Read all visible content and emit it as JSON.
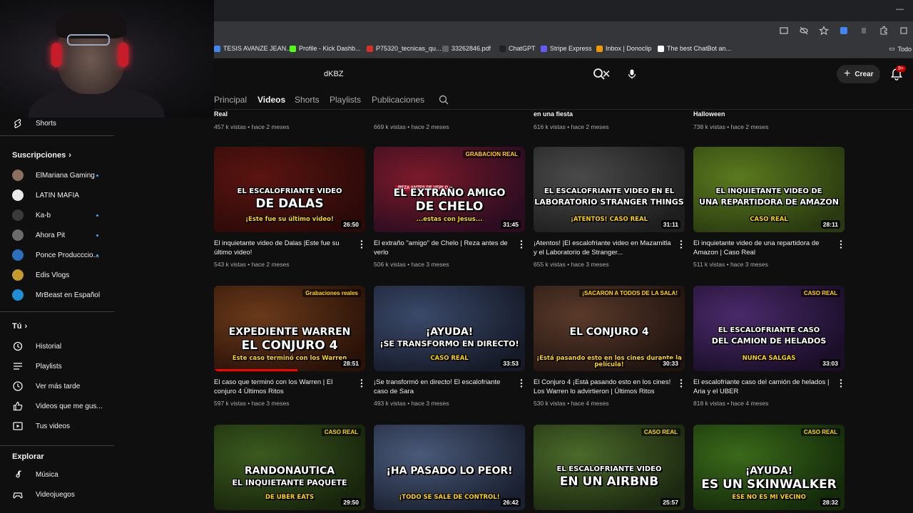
{
  "browser": {
    "bookmarks": [
      {
        "label": "TESIS AVANZE JEAN...",
        "color": "#4285f4"
      },
      {
        "label": "Profile - Kick Dashb...",
        "color": "#53fc18"
      },
      {
        "label": "P75320_tecnicas_qu...",
        "color": "#d93025"
      },
      {
        "label": "33262846.pdf",
        "color": "#5f6368"
      },
      {
        "label": "ChatGPT",
        "color": "#202124"
      },
      {
        "label": "Stripe Express",
        "color": "#635bff"
      },
      {
        "label": "Inbox | Donoclip",
        "color": "#f29900"
      },
      {
        "label": "The best ChatBot an...",
        "color": "#ffffff"
      }
    ],
    "more_bookmarks": "Todo"
  },
  "header": {
    "search_value": "dKBZ",
    "create_label": "Crear",
    "notifications": "9+"
  },
  "channel_tabs": [
    {
      "label": "Principal",
      "active": false
    },
    {
      "label": "Videos",
      "active": true
    },
    {
      "label": "Shorts",
      "active": false
    },
    {
      "label": "Playlists",
      "active": false
    },
    {
      "label": "Publicaciones",
      "active": false
    }
  ],
  "sidebar": {
    "shorts": "Shorts",
    "subscriptions_title": "Suscripciones",
    "subscriptions": [
      {
        "name": "ElMariana Gaming",
        "color": "#8a6f5c",
        "dot": true
      },
      {
        "name": "LATIN MAFIA",
        "color": "#e8e8e8",
        "dot": false
      },
      {
        "name": "Ka-b",
        "color": "#3a3a3a",
        "dot": true
      },
      {
        "name": "Ahora Pit",
        "color": "#6b6b6b",
        "dot": true
      },
      {
        "name": "Ponce Producccio...",
        "color": "#2c6fbf",
        "dot": true
      },
      {
        "name": "Edis Vlogs",
        "color": "#c49a2c",
        "dot": false
      },
      {
        "name": "MrBeast en Español",
        "color": "#1e8fd6",
        "dot": false
      }
    ],
    "you_title": "Tú",
    "you_items": [
      {
        "label": "Historial",
        "icon": "history-icon"
      },
      {
        "label": "Playlists",
        "icon": "playlists-icon"
      },
      {
        "label": "Ver más tarde",
        "icon": "watch-later-icon"
      },
      {
        "label": "Videos que me gus...",
        "icon": "like-icon"
      },
      {
        "label": "Tus videos",
        "icon": "your-videos-icon"
      }
    ],
    "explore_title": "Explorar",
    "explore_items": [
      {
        "label": "Música",
        "icon": "music-icon"
      },
      {
        "label": "Videojuegos",
        "icon": "gaming-icon"
      }
    ]
  },
  "top_row": [
    {
      "title": "Real",
      "meta": "457 k vistas • hace 2 meses"
    },
    {
      "title": "",
      "meta": "669 k vistas • hace 2 meses"
    },
    {
      "title": "en una fiesta",
      "meta": "616 k vistas • hace 2 meses"
    },
    {
      "title": "Halloween",
      "meta": "738 k vistas • hace 2 meses"
    }
  ],
  "videos": [
    {
      "title": "El inquietante video de Dalas |Este fue su último video!",
      "meta": "543 k vistas • hace 2 meses",
      "duration": "26:50",
      "thumb_text": "EL ESCALOFRIANTE VIDEO",
      "thumb_big": "DE DALAS",
      "thumb_sub": "¡Este fue su último video!",
      "bg": "#5a1410",
      "bg2": "#2a0a08",
      "progress": 0
    },
    {
      "title": "El extraño \"amigo\" de Chelo | Reza antes de verlo",
      "meta": "506 k vistas • hace 3 meses",
      "duration": "31:45",
      "thumb_text": "EL EXTRAÑO AMIGO",
      "thumb_big": "DE CHELO",
      "thumb_sub": "...estas con Jesus...",
      "badge": "GRABACION REAL",
      "badge2": "REZA ANTES DE VERLO",
      "bg": "#7a1a2a",
      "bg2": "#2b0c20",
      "progress": 0
    },
    {
      "title": "¡Atentos! |El escalofriante video en Mazamitla y el Laboratorio de Stranger...",
      "meta": "655 k vistas • hace 3 meses",
      "duration": "31:11",
      "thumb_text": "EL ESCALOFRIANTE VIDEO EN EL",
      "thumb_big": "LABORATORIO STRANGER THINGS",
      "thumb_sub": "¡ATENTOS! CASO REAL",
      "bg": "#4a4a4a",
      "bg2": "#1e1e1e",
      "progress": 0
    },
    {
      "title": "El inquietante video de una repartidora de Amazon | Caso Real",
      "meta": "511 k vistas • hace 3 meses",
      "duration": "28:11",
      "thumb_text": "EL INQUIETANTE VIDEO DE",
      "thumb_big": "UNA REPARTIDORA DE AMAZON",
      "thumb_sub": "CASO REAL",
      "bg": "#5a7a1e",
      "bg2": "#2a3a10",
      "progress": 0
    },
    {
      "title": "El caso que terminó con los Warren | El conjuro 4 Últimos Ritos",
      "meta": "597 k vistas • hace 3 meses",
      "duration": "28:51",
      "thumb_text": "EXPEDIENTE WARREN",
      "thumb_big": "EL CONJURO 4",
      "thumb_sub": "Este caso terminó con los Warren",
      "badge": "Grabaciones reales",
      "bg": "#6a3a1a",
      "bg2": "#2a1208",
      "progress": 0.55
    },
    {
      "title": "¡Se transformó en directo! El escalofriante caso de Sara",
      "meta": "493 k vistas • hace 3 meses",
      "duration": "33:53",
      "thumb_text": "¡AYUDA!",
      "thumb_big": "¡SE TRANSFORMO EN DIRECTO!",
      "thumb_sub": "CASO REAL",
      "bg": "#3a4a6a",
      "bg2": "#161a28",
      "progress": 0
    },
    {
      "title": "El Conjuro 4 ¡Está pasando esto en los cines! Los Warren lo advirtieron | Últimos Ritos",
      "meta": "530 k vistas • hace 4 meses",
      "duration": "30:33",
      "thumb_text": "EL CONJURO 4",
      "thumb_big": "",
      "thumb_sub": "¡Está pasando esto en los cines durante la película!",
      "badge": "¡SACARON A TODOS DE LA SALA!",
      "bg": "#5a3a2a",
      "bg2": "#201410",
      "progress": 0
    },
    {
      "title": "El escalofriante caso del camión de helados | Aria y el UBER",
      "meta": "818 k vistas • hace 4 meses",
      "duration": "33:03",
      "thumb_text": "EL ESCALOFRIANTE CASO",
      "thumb_big": "DEL CAMION DE HELADOS",
      "thumb_sub": "NUNCA SALGAS",
      "badge": "CASO REAL",
      "bg": "#4a2a6a",
      "bg2": "#1a0e28",
      "progress": 0
    },
    {
      "title": "",
      "meta": "",
      "duration": "29:50",
      "thumb_text": "RANDONAUTICA",
      "thumb_big": "EL INQUIETANTE PAQUETE",
      "thumb_sub": "DE UBER EATS",
      "badge": "CASO REAL",
      "bg": "#3a5a1e",
      "bg2": "#18240c",
      "progress": 0
    },
    {
      "title": "",
      "meta": "",
      "duration": "26:42",
      "thumb_text": "¡HA PASADO LO PEOR!",
      "thumb_big": "",
      "thumb_sub": "¡TODO SE SALE DE CONTROL!",
      "bg": "#4a5a7a",
      "bg2": "#1a2030",
      "progress": 0
    },
    {
      "title": "",
      "meta": "",
      "duration": "25:57",
      "thumb_text": "EL ESCALOFRIANTE VIDEO",
      "thumb_big": "EN UN AIRBNB",
      "thumb_sub": "",
      "badge": "CASO REAL",
      "bg": "#4a6a2a",
      "bg2": "#1c2810",
      "progress": 0
    },
    {
      "title": "",
      "meta": "",
      "duration": "28:32",
      "thumb_text": "¡AYUDA!",
      "thumb_big": "ES UN SKINWALKER",
      "thumb_sub": "ESE NO ES MI VECINO",
      "badge": "CASO REAL",
      "bg": "#3a6a1a",
      "bg2": "#142a0a",
      "progress": 0
    }
  ],
  "colors": {
    "accent": "#ff0000",
    "link": "#3ea6ff",
    "badge_yellow": "#ffd400"
  }
}
